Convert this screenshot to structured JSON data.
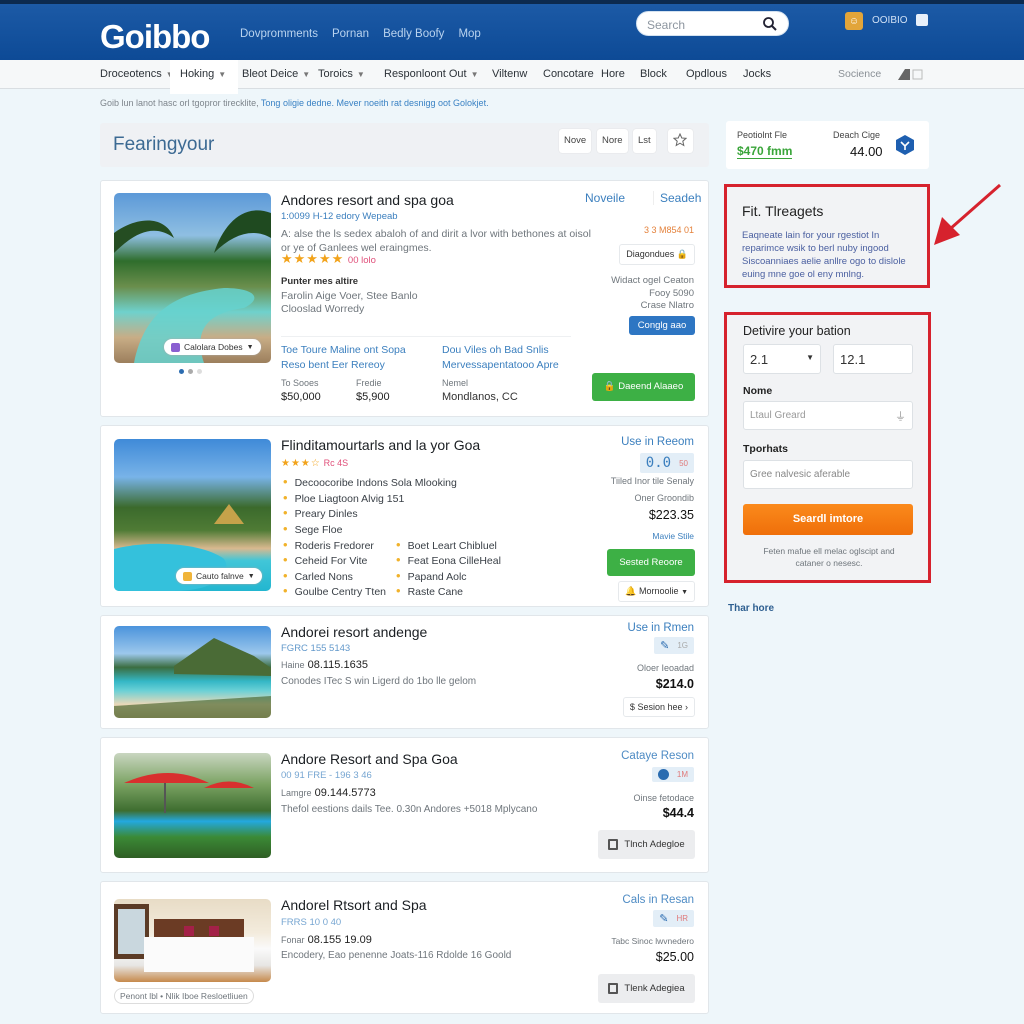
{
  "header": {
    "logo": "Goibbo",
    "links": [
      "Dovpromments",
      "Pornan",
      "Bedly Boofy",
      "Mop"
    ],
    "search_placeholder": "Search",
    "account_label": "OOIBIO"
  },
  "nav": {
    "items": [
      "Droceotencs",
      "Hoking",
      "Bleot Deice",
      "Toroics",
      "Responloont Out",
      "Viltenw",
      "Concotare",
      "Hore",
      "Block",
      "Opdlous",
      "Jocks"
    ],
    "active": "Hoking",
    "right_label": "Socience"
  },
  "breadcrumb": {
    "text": "Goib lun lanot hasc orl tgopror tirecklite,",
    "link": "Tong oligie dedne. Mever noeith rat desnigg oot Golokjet."
  },
  "results_header": {
    "title": "Fearingyour",
    "buttons": [
      "Nove",
      "Nore",
      "Lst"
    ]
  },
  "listings": [
    {
      "name": "Andores resort and spa goa",
      "sub": "1:0099 H-12 edory Wepeab",
      "desc": "A: alse the ls sedex abaloh of and dirit a lvor with bethones at oisol or ye of Ganlees wel eraingmes.",
      "stars": "★★★★★",
      "rating": "00 lolo",
      "photo_pill": "Calolara Dobes",
      "amen_title": "Punter mes altire",
      "amen_lines": [
        "Farolin Aige Voer, Stee Banlo",
        "Clooslad Worredy"
      ],
      "link1": "Toe Toure Maline ont Sopa Reso bent Eer Rereoy",
      "link2": "Dou Viles oh Bad Snlis Mervessapentatooo Apre",
      "price_labels": [
        "To Sooes",
        "Fredie",
        "Nemel"
      ],
      "price_values": [
        "$50,000",
        "$5,900",
        "Mondlanos, CC"
      ],
      "tabs": [
        "Noveile",
        "Seadeh"
      ],
      "orange_text": "3 3 M854 01",
      "ghost_btn": "Diagondues",
      "side_lines": [
        "Widact ogel Ceaton",
        "Fooy 5090",
        "Crase Nlatro"
      ],
      "blue_btn": "Conglg aao",
      "green_btn": "Daeend Alaaeo"
    },
    {
      "name": "Flinditamourtarls and la yor Goa",
      "stars": "★★★☆",
      "rating": "Rc 4S",
      "bullets": [
        "Decoocoribe Indons Sola Mlooking",
        "Ploe Liagtoon Alvig 151",
        "Preary Dinles",
        "Sege Floe",
        "Roderis Fredorer",
        "Ceheid For Vite",
        "Carled Nons",
        "Goulbe Centry Tten"
      ],
      "bullets2": [
        "Boet Leart Chibluel",
        "Feat Eona CilleHeal",
        "Papand Aolc",
        "Raste Cane"
      ],
      "photo_pill": "Cauto falnve",
      "side_title": "Use in Reeom",
      "score": "0.0",
      "score_unit": "50",
      "side_lines": [
        "Tiiled Inor tile Senaly",
        "Oner Groondib"
      ],
      "price": "$223.35",
      "link": "Mavie Stile",
      "green_btn": "Sested Reoore",
      "ghost_btn": "Mornoolie"
    },
    {
      "name": "Andorei resort andenge",
      "sub": "FGRC 155 5143",
      "date_label": "Haine",
      "date": "08.115.1635",
      "desc": "Conodes ITec S win Ligerd do 1bo lle gelom",
      "side_title": "Use in Rmen",
      "badge": "1G",
      "side_line": "Oloer Ieoadad",
      "price": "$214.0",
      "ghost_btn": "Sesion hee"
    },
    {
      "name": "Andore Resort and Spa Goa",
      "sub": "00 91 FRE - 196 3 46",
      "date_label": "Lamgre",
      "date": "09.144.5773",
      "desc": "Thefol eestions dails Tee. 0.30n Andores +5018 Mplycano",
      "side_title": "Cataye Reson",
      "badge": "1M",
      "side_line": "Oinse fetodace",
      "price": "$44.4",
      "gray_btn": "Tlnch Adegloe"
    },
    {
      "name": "Andorel Rtsort and Spa",
      "sub": "FRRS 10 0 40",
      "date_label": "Fonar",
      "date": "08.155 19.09",
      "desc": "Encodery, Eao penenne Joats-116 Rdolde 16 Goold",
      "photo_caption": "Penont lbl • Nlik Iboe Resloetliuen",
      "side_title": "Cals in Resan",
      "badge": "HR",
      "side_line": "Tabc Sinoc lwvnedero",
      "price": "$25.00",
      "gray_btn": "Tlenk Adegiea"
    }
  ],
  "sidebar": {
    "summary": {
      "label1": "Peotiolnt Fle",
      "value1": "$470 fmm",
      "label2": "Deach Cige",
      "value2": "44.00"
    },
    "tip": {
      "title": "Fit. Tlreagets",
      "text": "Eaqneate lain for your rgestiot In reparimce wsik to berl nuby ingood Siscoanniaes aelie anllre ogo to dislole euing mne goe ol eny mnlng."
    },
    "form": {
      "title": "Detivire your bation",
      "select_value": "2.1",
      "input_value": "12.1",
      "name_label": "Nome",
      "name_placeholder": "Ltaul Greard",
      "type_label": "Tporhats",
      "type_placeholder": "Gree nalvesic aferable",
      "submit": "Seardl imtore",
      "note": "Feten mafue ell melac oglscipt and cataner o nesesc."
    },
    "link": "Thar hore"
  },
  "colors": {
    "brand": "#1559a3",
    "accent_green": "#3db045",
    "accent_orange": "#f57d12",
    "highlight_red": "#d6222d"
  }
}
